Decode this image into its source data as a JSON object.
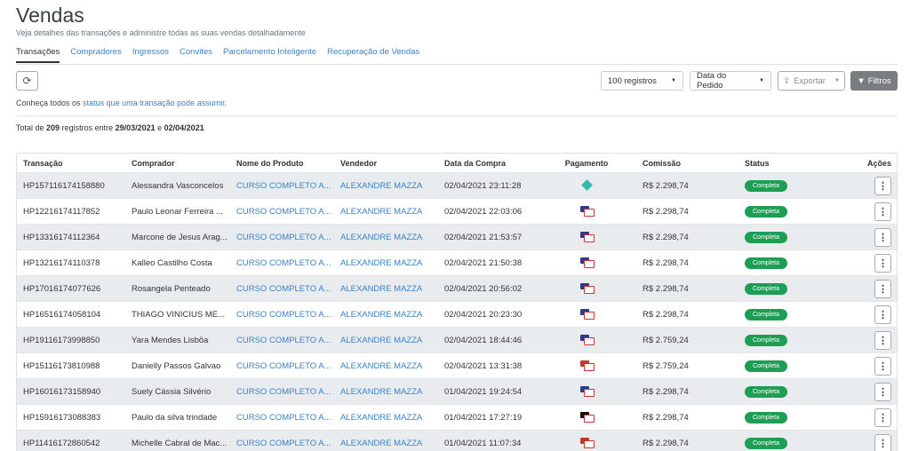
{
  "header": {
    "title": "Vendas",
    "subtitle": "Veja detalhes das transações e administre todas as suas vendas detalhadamente"
  },
  "tabs": [
    "Transações",
    "Compradores",
    "Ingressos",
    "Convites",
    "Parcelamento Inteligente",
    "Recuperação de Vendas"
  ],
  "toolbar": {
    "refresh_icon": "refresh-icon",
    "records_select": "100 registros",
    "order_select": "Data do Pedido",
    "export_label": "Exportar",
    "filters_label": "Filtros"
  },
  "info": {
    "prefix": "Conheça todos os ",
    "link": "status que uma transação pode assumir",
    "suffix": "."
  },
  "total": {
    "t1": "Total de ",
    "count": "209",
    "t2": " registros entre ",
    "start": "29/03/2021",
    "t3": " e ",
    "end": "02/04/2021"
  },
  "table": {
    "headers": [
      "Transação",
      "Comprador",
      "Nome do Produto",
      "Vendedor",
      "Data da Compra",
      "Pagamento",
      "Comissão",
      "Status",
      "Ações"
    ],
    "rows": [
      {
        "id": "HP157116174158880",
        "buyer": "Alessandra Vasconcelos",
        "product": "CURSO COMPLETO A...",
        "seller": "ALEXANDRE MAZZA",
        "date": "02/04/2021 23:11:28",
        "payment": "pix",
        "commission": "R$ 2.298,74",
        "status": "Completa"
      },
      {
        "id": "HP12216174117852",
        "buyer": "Paulo Leonar Ferreira ...",
        "product": "CURSO COMPLETO A...",
        "seller": "ALEXANDRE MAZZA",
        "date": "02/04/2021 22:03:06",
        "payment": "card",
        "commission": "R$ 2.298,74",
        "status": "Completa"
      },
      {
        "id": "HP13316174112364",
        "buyer": "Marcone de Jesus Arag...",
        "product": "CURSO COMPLETO A...",
        "seller": "ALEXANDRE MAZZA",
        "date": "02/04/2021 21:53:57",
        "payment": "card",
        "commission": "R$ 2.298,74",
        "status": "Completa"
      },
      {
        "id": "HP13216174110378",
        "buyer": "Kalleo Castilho Costa",
        "product": "CURSO COMPLETO A...",
        "seller": "ALEXANDRE MAZZA",
        "date": "02/04/2021 21:50:38",
        "payment": "card",
        "commission": "R$ 2.298,74",
        "status": "Completa"
      },
      {
        "id": "HP17016174077626",
        "buyer": "Rosangela Penteado",
        "product": "CURSO COMPLETO A...",
        "seller": "ALEXANDRE MAZZA",
        "date": "02/04/2021 20:56:02",
        "payment": "card",
        "commission": "R$ 2.298,74",
        "status": "Completa"
      },
      {
        "id": "HP16516174058104",
        "buyer": "THIAGO VINICIUS ME...",
        "product": "CURSO COMPLETO A...",
        "seller": "ALEXANDRE MAZZA",
        "date": "02/04/2021 20:23:30",
        "payment": "card",
        "commission": "R$ 2.298,74",
        "status": "Completa"
      },
      {
        "id": "HP19116173998850",
        "buyer": "Yara Mendes Lisbôa",
        "product": "CURSO COMPLETO A...",
        "seller": "ALEXANDRE MAZZA",
        "date": "02/04/2021 18:44:46",
        "payment": "card",
        "commission": "R$ 2.759,24",
        "status": "Completa"
      },
      {
        "id": "HP15116173810988",
        "buyer": "Danielly Passos Galvao",
        "product": "CURSO COMPLETO A...",
        "seller": "ALEXANDRE MAZZA",
        "date": "02/04/2021 13:31:38",
        "payment": "card-mc",
        "commission": "R$ 2.759,24",
        "status": "Completa"
      },
      {
        "id": "HP16016173158940",
        "buyer": "Suely Cássia Silvério",
        "product": "CURSO COMPLETO A...",
        "seller": "ALEXANDRE MAZZA",
        "date": "01/04/2021 19:24:54",
        "payment": "card",
        "commission": "R$ 2.298,74",
        "status": "Completa"
      },
      {
        "id": "HP15916173088383",
        "buyer": "Paulo da silva trindade",
        "product": "CURSO COMPLETO A...",
        "seller": "ALEXANDRE MAZZA",
        "date": "01/04/2021 17:27:19",
        "payment": "card-dark",
        "commission": "R$ 2.298,74",
        "status": "Completa"
      },
      {
        "id": "HP11416172860542",
        "buyer": "Michelle Cabral de Mac...",
        "product": "CURSO COMPLETO A...",
        "seller": "ALEXANDRE MAZZA",
        "date": "01/04/2021 11:07:34",
        "payment": "card-mc",
        "commission": "R$ 2.298,74",
        "status": "Completa"
      }
    ]
  },
  "colors": {
    "accent": "#3b82c4",
    "status_green": "#1e9e54",
    "filter_button": "#7a7d80"
  }
}
